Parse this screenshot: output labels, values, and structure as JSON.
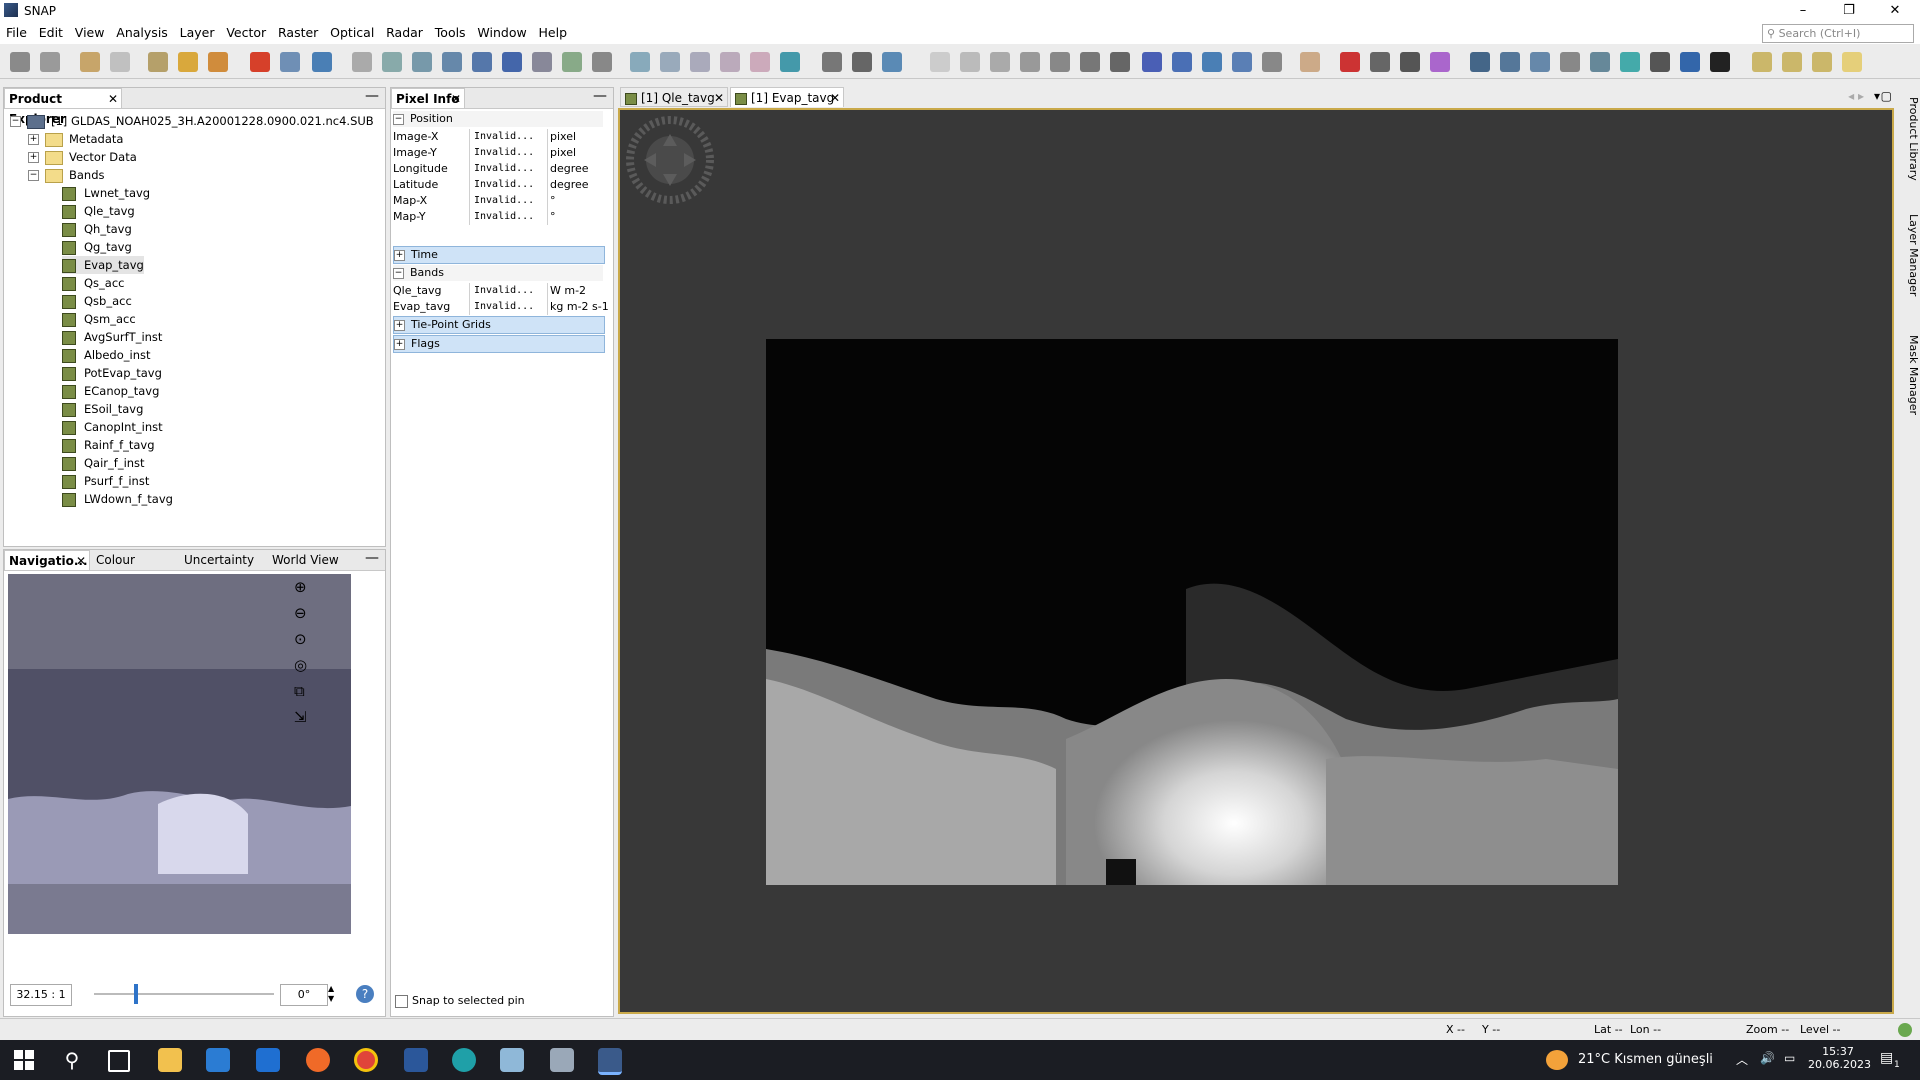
{
  "app": {
    "title": "SNAP"
  },
  "window": {
    "minimize": "–",
    "restore": "❐",
    "close": "✕"
  },
  "menu": [
    "File",
    "Edit",
    "View",
    "Analysis",
    "Layer",
    "Vector",
    "Raster",
    "Optical",
    "Radar",
    "Tools",
    "Window",
    "Help"
  ],
  "search": {
    "placeholder": "Search (Ctrl+I)"
  },
  "product_explorer": {
    "title": "Product Explorer",
    "product": "[1] GLDAS_NOAH025_3H.A20001228.0900.021.nc4.SUB",
    "folders": [
      "Metadata",
      "Vector Data",
      "Bands"
    ],
    "bands": [
      "Lwnet_tavg",
      "Qle_tavg",
      "Qh_tavg",
      "Qg_tavg",
      "Evap_tavg",
      "Qs_acc",
      "Qsb_acc",
      "Qsm_acc",
      "AvgSurfT_inst",
      "Albedo_inst",
      "PotEvap_tavg",
      "ECanop_tavg",
      "ESoil_tavg",
      "CanopInt_inst",
      "Rainf_f_tavg",
      "Qair_f_inst",
      "Psurf_f_inst",
      "LWdown_f_tavg"
    ],
    "selected_band": "Evap_tavg"
  },
  "pixel_info": {
    "title": "Pixel Info",
    "position_label": "Position",
    "position_rows": [
      {
        "name": "Image-X",
        "value": "Invalid...",
        "unit": "pixel"
      },
      {
        "name": "Image-Y",
        "value": "Invalid...",
        "unit": "pixel"
      },
      {
        "name": "Longitude",
        "value": "Invalid...",
        "unit": "degree"
      },
      {
        "name": "Latitude",
        "value": "Invalid...",
        "unit": "degree"
      },
      {
        "name": "Map-X",
        "value": "Invalid...",
        "unit": "°"
      },
      {
        "name": "Map-Y",
        "value": "Invalid...",
        "unit": "°"
      }
    ],
    "time_label": "Time",
    "bands_label": "Bands",
    "band_rows": [
      {
        "name": "Qle_tavg",
        "value": "Invalid...",
        "unit": "W m-2"
      },
      {
        "name": "Evap_tavg",
        "value": "Invalid...",
        "unit": "kg m-2 s-1"
      }
    ],
    "tiepoint_label": "Tie-Point Grids",
    "flags_label": "Flags",
    "snap_pin_label": "Snap to selected pin"
  },
  "nav_panel": {
    "tabs": [
      "Navigatio...",
      "Colour Mani...",
      "Uncertainty ...",
      "World View"
    ],
    "zoom_ratio": "32.15 : 1",
    "rotation": "0°",
    "zoom_level_fraction": 0.03
  },
  "image_tabs": [
    {
      "label": "[1] Qle_tavg"
    },
    {
      "label": "[1] Evap_tavg"
    }
  ],
  "right_side_tabs": [
    "Product Library",
    "Layer Manager",
    "Mask Manager"
  ],
  "status": {
    "x": "X",
    "x_val": "--",
    "y": "Y",
    "y_val": "--",
    "lat": "Lat",
    "lat_val": "--",
    "lon": "Lon",
    "lon_val": "--",
    "zoom": "Zoom",
    "zoom_val": "--",
    "level": "Level",
    "level_val": "--"
  },
  "taskbar": {
    "weather": "21°C  Kısmen güneşli",
    "time": "15:37",
    "date": "20.06.2023",
    "notif": "1"
  }
}
